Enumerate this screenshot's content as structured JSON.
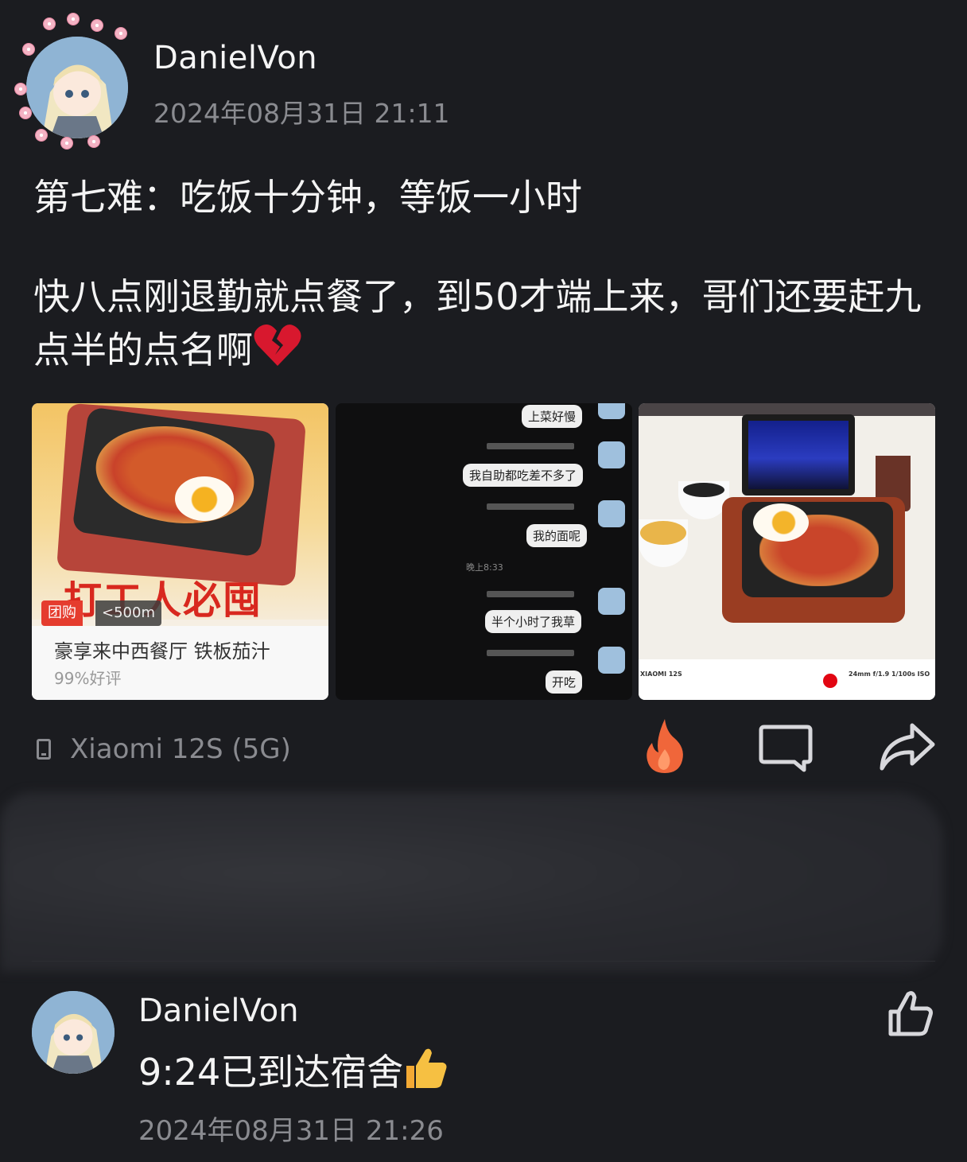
{
  "post": {
    "username": "DanielVon",
    "time": "2024年08月31日 21:11",
    "title": "第七难：吃饭十分钟，等饭一小时",
    "body": "快八点刚退勤就点餐了，到50才端上来，哥们还要赶九点半的点名啊",
    "body_emoji": "broken-heart-icon",
    "images": [
      {
        "slogan": "打工人必囤",
        "tag_group": "团购",
        "tag_distance": "<500m",
        "shop_name": "豪享来中西餐厅 铁板茄汁",
        "rating": "99%好评"
      },
      {
        "messages": [
          {
            "text": "上菜好慢"
          },
          {
            "text": "我自助都吃差不多了"
          },
          {
            "text": "我的面呢"
          },
          {
            "text": "半个小时了我草"
          },
          {
            "text": "开吃"
          }
        ],
        "timestamp": "晚上8:33"
      },
      {
        "exif_left": "XIAOMI 12S",
        "exif_right": "24mm f/1.9 1/100s ISO"
      }
    ]
  },
  "action_bar": {
    "device": "Xiaomi 12S (5G)",
    "fire_color": "#f0663a"
  },
  "comment": {
    "username": "DanielVon",
    "text": "9:24已到达宿舍",
    "emoji": "thumbs-up-icon",
    "time": "2024年08月31日 21:26"
  }
}
